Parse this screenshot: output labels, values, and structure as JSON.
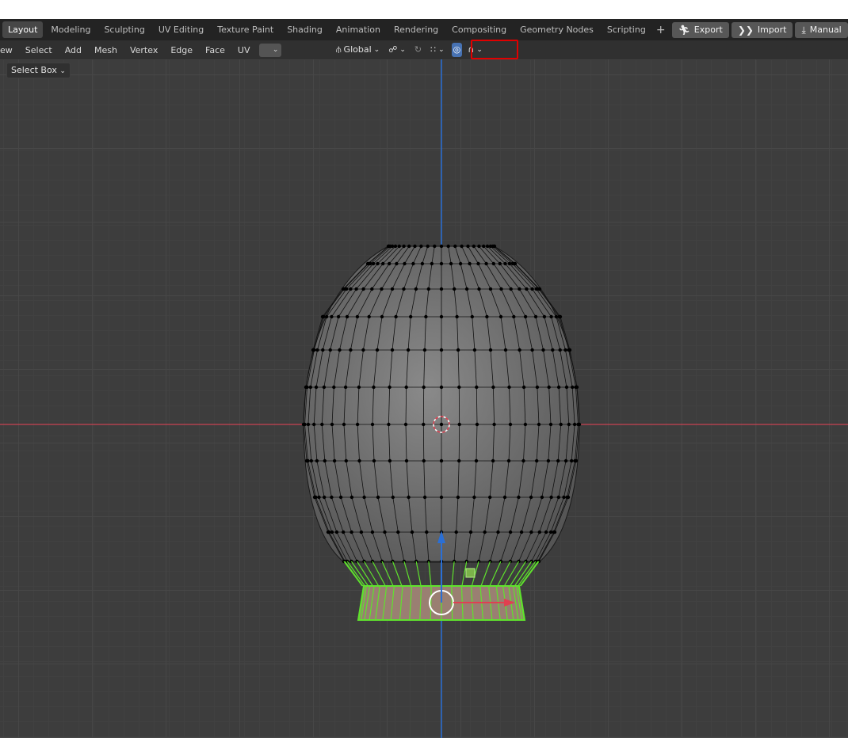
{
  "workspace_tabs": [
    {
      "label": "Layout",
      "active": true
    },
    {
      "label": "Modeling"
    },
    {
      "label": "Sculpting"
    },
    {
      "label": "UV Editing"
    },
    {
      "label": "Texture Paint"
    },
    {
      "label": "Shading"
    },
    {
      "label": "Animation"
    },
    {
      "label": "Rendering"
    },
    {
      "label": "Compositing"
    },
    {
      "label": "Geometry Nodes"
    },
    {
      "label": "Scripting"
    }
  ],
  "add_workspace": "+",
  "addon_buttons": [
    {
      "label": "Export",
      "icon": "runner-icon"
    },
    {
      "label": "Import",
      "icon": "double-chevron-icon"
    },
    {
      "label": "Manual",
      "icon": "download-arrow-icon"
    }
  ],
  "header_menu": [
    "ew",
    "Select",
    "Add",
    "Mesh",
    "Vertex",
    "Edge",
    "Face",
    "UV"
  ],
  "transform_orientation": "Global",
  "select_mode": "Select Box",
  "proportional_editing": {
    "enabled": true,
    "falloff": "sharp",
    "icon": "proportional-target-icon"
  },
  "colors": {
    "x_axis": "#c94352",
    "y_axis": "#2a6fd6",
    "selection": "#5fe22d",
    "highlight_box": "#e00000",
    "active_tab_bg": "#474747"
  }
}
